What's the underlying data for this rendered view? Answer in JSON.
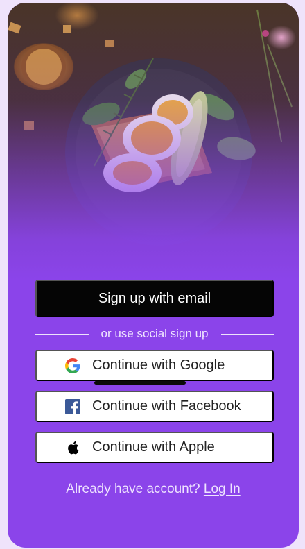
{
  "hero": {
    "image": "food-photo-eggs-toast-plate",
    "accent_color": "#8b44ea"
  },
  "actions": {
    "email_signup_label": "Sign up with email",
    "divider_text": "or use social sign up",
    "google_label": "Continue with Google",
    "facebook_label": "Continue with Facebook",
    "apple_label": "Continue with Apple"
  },
  "icons": {
    "google": "google-icon",
    "facebook": "facebook-icon",
    "apple": "apple-icon"
  },
  "footer": {
    "prompt": "Already have account?",
    "login_link": "Log In"
  },
  "colors": {
    "background": "#efe3fb",
    "primary": "#8b44ea",
    "email_button": "#050505",
    "facebook_blue": "#3b5998"
  }
}
